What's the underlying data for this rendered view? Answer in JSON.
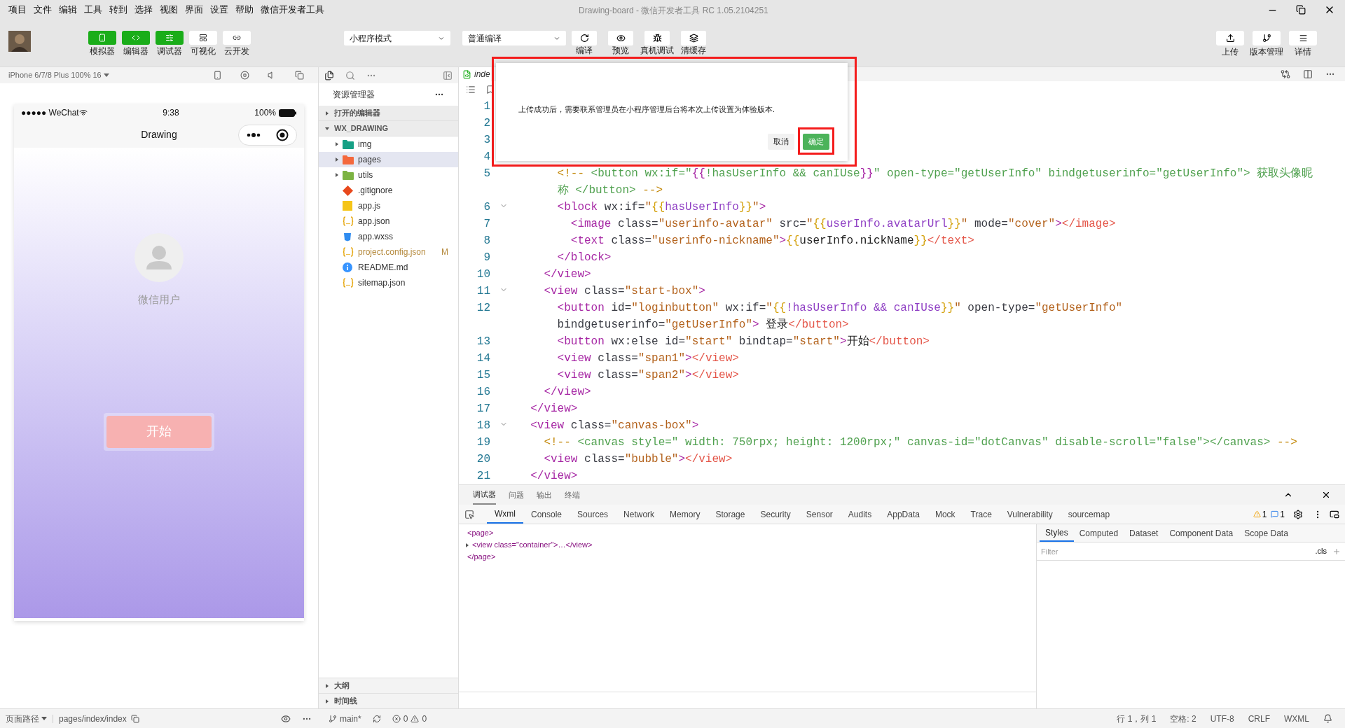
{
  "menu_bar": {
    "items": [
      "项目",
      "文件",
      "编辑",
      "工具",
      "转到",
      "选择",
      "视图",
      "界面",
      "设置",
      "帮助",
      "微信开发者工具"
    ],
    "title": "Drawing-board - 微信开发者工具 RC 1.05.2104251"
  },
  "toolbar": {
    "view_toggles": [
      {
        "label": "模拟器",
        "kind": "simulator",
        "selected": true
      },
      {
        "label": "编辑器",
        "kind": "editor",
        "selected": true
      },
      {
        "label": "调试器",
        "kind": "debugger",
        "selected": true
      },
      {
        "label": "可视化",
        "kind": "visual",
        "selected": false
      },
      {
        "label": "云开发",
        "kind": "cloud",
        "selected": false
      }
    ],
    "mode_select": "小程序模式",
    "compile_select": "普通编译",
    "actions": [
      {
        "label": "编译",
        "kind": "compile"
      },
      {
        "label": "预览",
        "kind": "preview"
      },
      {
        "label": "真机调试",
        "kind": "debug"
      },
      {
        "label": "清缓存",
        "kind": "cache"
      }
    ],
    "right_actions": [
      {
        "label": "上传",
        "kind": "upload"
      },
      {
        "label": "版本管理",
        "kind": "version"
      },
      {
        "label": "详情",
        "kind": "details"
      }
    ]
  },
  "simulator": {
    "device": "iPhone 6/7/8 Plus 100% 16",
    "phone": {
      "carrier": "●●●●● WeChat",
      "time": "9:38",
      "battery": "100%",
      "nav_title": "Drawing",
      "user_name": "微信用户",
      "start_button": "开始"
    }
  },
  "explorer": {
    "title": "资源管理器",
    "sections": [
      {
        "label": "打开的编辑器",
        "expanded": false
      },
      {
        "label": "WX_DRAWING",
        "expanded": true,
        "children": [
          {
            "name": "img",
            "kind": "folder",
            "color": "#16a085",
            "expanded": false,
            "selected": false
          },
          {
            "name": "pages",
            "kind": "folder",
            "color": "#f4683c",
            "expanded": false,
            "selected": true
          },
          {
            "name": "utils",
            "kind": "folder",
            "color": "#7cb342",
            "expanded": false,
            "selected": false
          },
          {
            "name": ".gitignore",
            "kind": "git",
            "selected": false
          },
          {
            "name": "app.js",
            "kind": "js",
            "selected": false
          },
          {
            "name": "app.json",
            "kind": "json",
            "selected": false
          },
          {
            "name": "app.wxss",
            "kind": "wxss",
            "selected": false
          },
          {
            "name": "project.config.json",
            "kind": "json",
            "status": "M",
            "selected": false
          },
          {
            "name": "README.md",
            "kind": "info",
            "selected": false
          },
          {
            "name": "sitemap.json",
            "kind": "json",
            "selected": false
          }
        ]
      }
    ],
    "footer_sections": [
      {
        "label": "大纲",
        "expanded": false
      },
      {
        "label": "时间线",
        "expanded": false
      }
    ]
  },
  "editor": {
    "tab": "inde",
    "lines": [
      {
        "number": "1",
        "fold": false
      },
      {
        "number": "2",
        "fold": false
      },
      {
        "number": "3",
        "fold": false
      },
      {
        "number": "4",
        "fold": false
      },
      {
        "number": "5",
        "fold": false,
        "tokens": [
          {
            "kind": "cmark",
            "text": "      <!--"
          },
          {
            "kind": "comment",
            "text": " <button wx:if=\""
          },
          {
            "kind": "cbrace",
            "text": "{{"
          },
          {
            "kind": "comment",
            "text": "!hasUserInfo && canIUse"
          },
          {
            "kind": "cbrace",
            "text": "}}"
          },
          {
            "kind": "comment",
            "text": "\" open-type=\"getUserInfo\" bindgetuserinfo=\"getUserInfo\"> 获取头像昵称 </button> "
          },
          {
            "kind": "cmark",
            "text": "-->"
          }
        ]
      },
      {
        "number": "6",
        "fold": true,
        "tokens": [
          {
            "kind": "tag",
            "text": "      <block"
          },
          {
            "kind": "attr",
            "text": " wx:if="
          },
          {
            "kind": "str",
            "text": "\""
          },
          {
            "kind": "brace",
            "text": "{{"
          },
          {
            "kind": "expr",
            "text": "hasUserInfo"
          },
          {
            "kind": "brace",
            "text": "}}"
          },
          {
            "kind": "str",
            "text": "\""
          },
          {
            "kind": "tag",
            "text": ">"
          }
        ]
      },
      {
        "number": "7",
        "fold": false,
        "tokens": [
          {
            "kind": "tag",
            "text": "        <image"
          },
          {
            "kind": "attr",
            "text": " class="
          },
          {
            "kind": "str",
            "text": "\"userinfo-avatar\""
          },
          {
            "kind": "attr",
            "text": " src="
          },
          {
            "kind": "str",
            "text": "\""
          },
          {
            "kind": "brace",
            "text": "{{"
          },
          {
            "kind": "expr",
            "text": "userInfo.avatarUrl"
          },
          {
            "kind": "brace",
            "text": "}}"
          },
          {
            "kind": "str",
            "text": "\""
          },
          {
            "kind": "attr",
            "text": " mode="
          },
          {
            "kind": "str",
            "text": "\"cover\""
          },
          {
            "kind": "tag",
            "text": ">"
          },
          {
            "kind": "close",
            "text": "</image>"
          }
        ]
      },
      {
        "number": "8",
        "fold": false,
        "tokens": [
          {
            "kind": "tag",
            "text": "        <text"
          },
          {
            "kind": "attr",
            "text": " class="
          },
          {
            "kind": "str",
            "text": "\"userinfo-nickname\""
          },
          {
            "kind": "tag",
            "text": ">"
          },
          {
            "kind": "brace",
            "text": "{{"
          },
          {
            "kind": "text",
            "text": "userInfo.nickName"
          },
          {
            "kind": "brace",
            "text": "}}"
          },
          {
            "kind": "close",
            "text": "</text>"
          }
        ]
      },
      {
        "number": "9",
        "fold": false,
        "tokens": [
          {
            "kind": "tag",
            "text": "      </block>"
          }
        ]
      },
      {
        "number": "10",
        "fold": false,
        "tokens": [
          {
            "kind": "tag",
            "text": "    </view>"
          }
        ]
      },
      {
        "number": "11",
        "fold": true,
        "tokens": [
          {
            "kind": "tag",
            "text": "    <view"
          },
          {
            "kind": "attr",
            "text": " class="
          },
          {
            "kind": "str",
            "text": "\"start-box\""
          },
          {
            "kind": "tag",
            "text": ">"
          }
        ]
      },
      {
        "number": "12",
        "fold": false,
        "tokens": [
          {
            "kind": "tag",
            "text": "      <button"
          },
          {
            "kind": "attr",
            "text": " id="
          },
          {
            "kind": "str",
            "text": "\"loginbutton\""
          },
          {
            "kind": "attr",
            "text": " wx:if="
          },
          {
            "kind": "str",
            "text": "\""
          },
          {
            "kind": "brace",
            "text": "{{"
          },
          {
            "kind": "expr",
            "text": "!hasUserInfo && canIUse"
          },
          {
            "kind": "brace",
            "text": "}}"
          },
          {
            "kind": "str",
            "text": "\""
          },
          {
            "kind": "attr",
            "text": " open-type="
          },
          {
            "kind": "str",
            "text": "\"getUserInfo\""
          },
          {
            "kind": "attr",
            "text": " bindgetuserinfo="
          },
          {
            "kind": "str",
            "text": "\"getUserInfo\""
          },
          {
            "kind": "tag",
            "text": ">"
          },
          {
            "kind": "text",
            "text": " 登录"
          },
          {
            "kind": "close",
            "text": "</button>"
          }
        ]
      },
      {
        "number": "13",
        "fold": false,
        "tokens": [
          {
            "kind": "tag",
            "text": "      <button"
          },
          {
            "kind": "attr",
            "text": " wx:else id="
          },
          {
            "kind": "str",
            "text": "\"start\""
          },
          {
            "kind": "attr",
            "text": " bindtap="
          },
          {
            "kind": "str",
            "text": "\"start\""
          },
          {
            "kind": "tag",
            "text": ">"
          },
          {
            "kind": "text",
            "text": "开始"
          },
          {
            "kind": "close",
            "text": "</button>"
          }
        ]
      },
      {
        "number": "14",
        "fold": false,
        "tokens": [
          {
            "kind": "tag",
            "text": "      <view"
          },
          {
            "kind": "attr",
            "text": " class="
          },
          {
            "kind": "str",
            "text": "\"span1\""
          },
          {
            "kind": "tag",
            "text": ">"
          },
          {
            "kind": "close",
            "text": "</view>"
          }
        ]
      },
      {
        "number": "15",
        "fold": false,
        "tokens": [
          {
            "kind": "tag",
            "text": "      <view"
          },
          {
            "kind": "attr",
            "text": " class="
          },
          {
            "kind": "str",
            "text": "\"span2\""
          },
          {
            "kind": "tag",
            "text": ">"
          },
          {
            "kind": "close",
            "text": "</view>"
          }
        ]
      },
      {
        "number": "16",
        "fold": false,
        "tokens": [
          {
            "kind": "tag",
            "text": "    </view>"
          }
        ]
      },
      {
        "number": "17",
        "fold": false,
        "tokens": [
          {
            "kind": "tag",
            "text": "  </view>"
          }
        ]
      },
      {
        "number": "18",
        "fold": true,
        "tokens": [
          {
            "kind": "tag",
            "text": "  <view"
          },
          {
            "kind": "attr",
            "text": " class="
          },
          {
            "kind": "str",
            "text": "\"canvas-box\""
          },
          {
            "kind": "tag",
            "text": ">"
          }
        ]
      },
      {
        "number": "19",
        "fold": false,
        "tokens": [
          {
            "kind": "cmark",
            "text": "    <!--"
          },
          {
            "kind": "comment",
            "text": " <canvas style=\" width: 750rpx; height: 1200rpx;\" canvas-id=\"dotCanvas\" disable-scroll=\"false\"></canvas> "
          },
          {
            "kind": "cmark",
            "text": "-->"
          }
        ]
      },
      {
        "number": "20",
        "fold": false,
        "tokens": [
          {
            "kind": "tag",
            "text": "    <view"
          },
          {
            "kind": "attr",
            "text": " class="
          },
          {
            "kind": "str",
            "text": "\"bubble\""
          },
          {
            "kind": "tag",
            "text": ">"
          },
          {
            "kind": "close",
            "text": "</view>"
          }
        ]
      },
      {
        "number": "21",
        "fold": false,
        "tokens": [
          {
            "kind": "tag",
            "text": "  </view>"
          }
        ]
      }
    ]
  },
  "dialog": {
    "highlighted": true,
    "message": "上传成功后，需要联系管理员在小程序管理后台将本次上传设置为体验版本.",
    "buttons": [
      {
        "label": "取消",
        "kind": "cancel",
        "highlighted": false
      },
      {
        "label": "确定",
        "kind": "confirm",
        "highlighted": true
      }
    ]
  },
  "devtools": {
    "panel_tabs": [
      {
        "label": "调试器",
        "selected": true
      },
      {
        "label": "问题",
        "selected": false
      },
      {
        "label": "输出",
        "selected": false
      },
      {
        "label": "终端",
        "selected": false
      }
    ],
    "tabs": [
      {
        "label": "Wxml",
        "selected": true
      },
      {
        "label": "Console",
        "selected": false
      },
      {
        "label": "Sources",
        "selected": false
      },
      {
        "label": "Network",
        "selected": false
      },
      {
        "label": "Memory",
        "selected": false
      },
      {
        "label": "Storage",
        "selected": false
      },
      {
        "label": "Security",
        "selected": false
      },
      {
        "label": "Sensor",
        "selected": false
      },
      {
        "label": "Audits",
        "selected": false
      },
      {
        "label": "AppData",
        "selected": false
      },
      {
        "label": "Mock",
        "selected": false
      },
      {
        "label": "Trace",
        "selected": false
      },
      {
        "label": "Vulnerability",
        "selected": false
      },
      {
        "label": "sourcemap",
        "selected": false
      }
    ],
    "warnings": "1",
    "messages": "1",
    "wxml": {
      "open": "<page>",
      "node": {
        "text": "<view class=\"container\">…</view>",
        "expanded": false
      },
      "close": "</page>"
    },
    "style_tabs": [
      {
        "label": "Styles",
        "selected": true
      },
      {
        "label": "Computed",
        "selected": false
      },
      {
        "label": "Dataset",
        "selected": false
      },
      {
        "label": "Component Data",
        "selected": false
      },
      {
        "label": "Scope Data",
        "selected": false
      }
    ],
    "filter_placeholder": "Filter",
    "cls": ".cls"
  },
  "status_bar": {
    "page_path_label": "页面路径",
    "page_path": "pages/index/index",
    "branch": "main*",
    "errors": "0",
    "warnings": "0",
    "position": "行 1，列 1",
    "spaces": "空格: 2",
    "encoding": "UTF-8",
    "eol": "CRLF",
    "language": "WXML"
  }
}
